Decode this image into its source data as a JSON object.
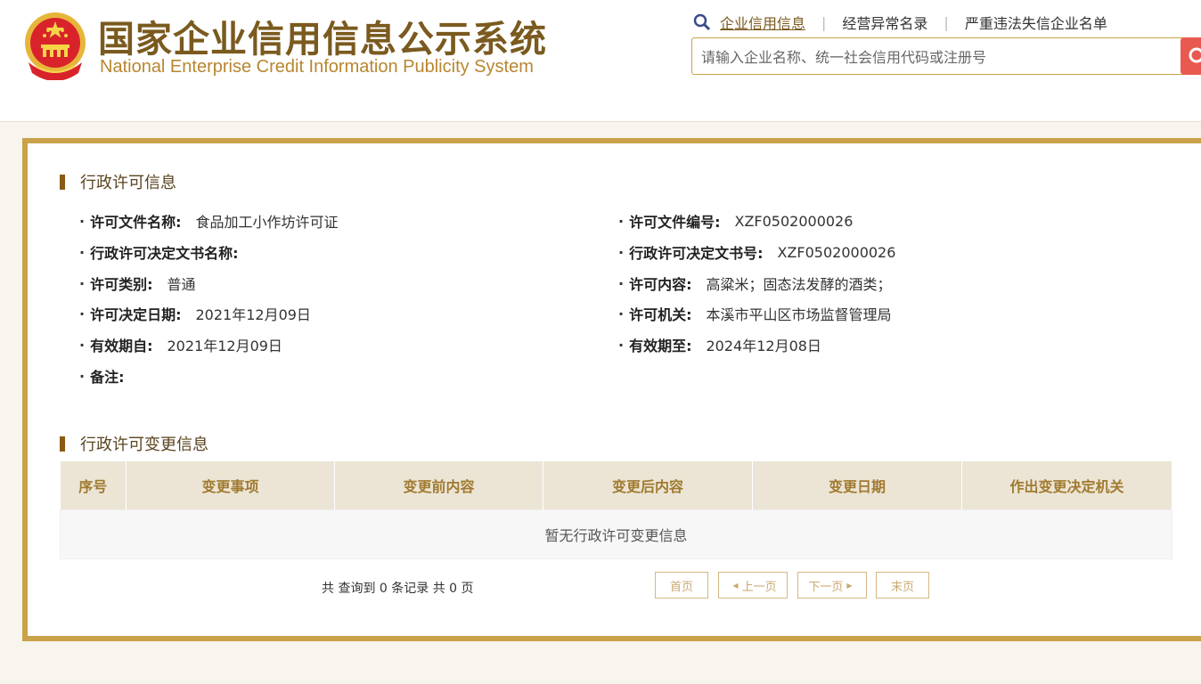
{
  "header": {
    "title_cn": "国家企业信用信息公示系统",
    "title_en": "National Enterprise Credit Information Publicity System",
    "nav": [
      {
        "label": "企业信用信息",
        "active": true
      },
      {
        "label": "经营异常名录",
        "active": false
      },
      {
        "label": "严重违法失信企业名单",
        "active": false
      }
    ],
    "search_placeholder": "请输入企业名称、统一社会信用代码或注册号"
  },
  "license": {
    "section_title": "行政许可信息",
    "left": [
      {
        "label": "许可文件名称:",
        "value": "食品加工小作坊许可证"
      },
      {
        "label": "行政许可决定文书名称:",
        "value": ""
      },
      {
        "label": "许可类别:",
        "value": "普通"
      },
      {
        "label": "许可决定日期:",
        "value": "2021年12月09日"
      },
      {
        "label": "有效期自:",
        "value": "2021年12月09日"
      },
      {
        "label": "备注:",
        "value": ""
      }
    ],
    "right": [
      {
        "label": "许可文件编号:",
        "value": "XZF0502000026"
      },
      {
        "label": "行政许可决定文书号:",
        "value": "XZF0502000026"
      },
      {
        "label": "许可内容:",
        "value": "高粱米；固态法发酵的酒类；"
      },
      {
        "label": "许可机关:",
        "value": "本溪市平山区市场监督管理局"
      },
      {
        "label": "有效期至:",
        "value": "2024年12月08日"
      }
    ]
  },
  "changes": {
    "section_title": "行政许可变更信息",
    "columns": [
      "序号",
      "变更事项",
      "变更前内容",
      "变更后内容",
      "变更日期",
      "作出变更决定机关"
    ],
    "empty_text": "暂无行政许可变更信息",
    "pager_info": "共 查询到 0 条记录 共 0 页",
    "pager": {
      "first": "首页",
      "prev": "上一页",
      "next": "下一页",
      "last": "末页"
    }
  },
  "colors": {
    "brand_gold": "#c9a24a",
    "brand_brown": "#7a5a1e",
    "search_red": "#e85a4f"
  }
}
